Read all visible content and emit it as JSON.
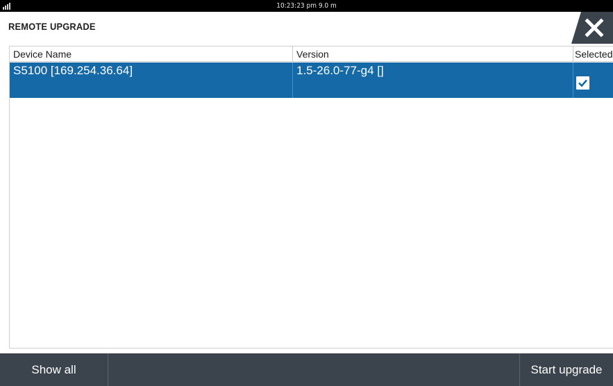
{
  "status_bar": {
    "signal_icon": "signal-bars-icon",
    "time_depth": "10:23:23 pm   9.0 m"
  },
  "dialog": {
    "title": "REMOTE UPGRADE",
    "close_icon": "close-icon"
  },
  "table": {
    "columns": [
      "Device Name",
      "Version",
      "Selected"
    ],
    "rows": [
      {
        "device_name": "S5100  [169.254.36.64]",
        "version": "1.5-26.0-77-g4 []",
        "selected": true
      }
    ]
  },
  "bottom_bar": {
    "left_button": "Show all",
    "right_button": "Start upgrade"
  },
  "colors": {
    "selected_row": "#1569a6",
    "bottom_bar": "#3b444c",
    "status_bar": "#000000"
  }
}
